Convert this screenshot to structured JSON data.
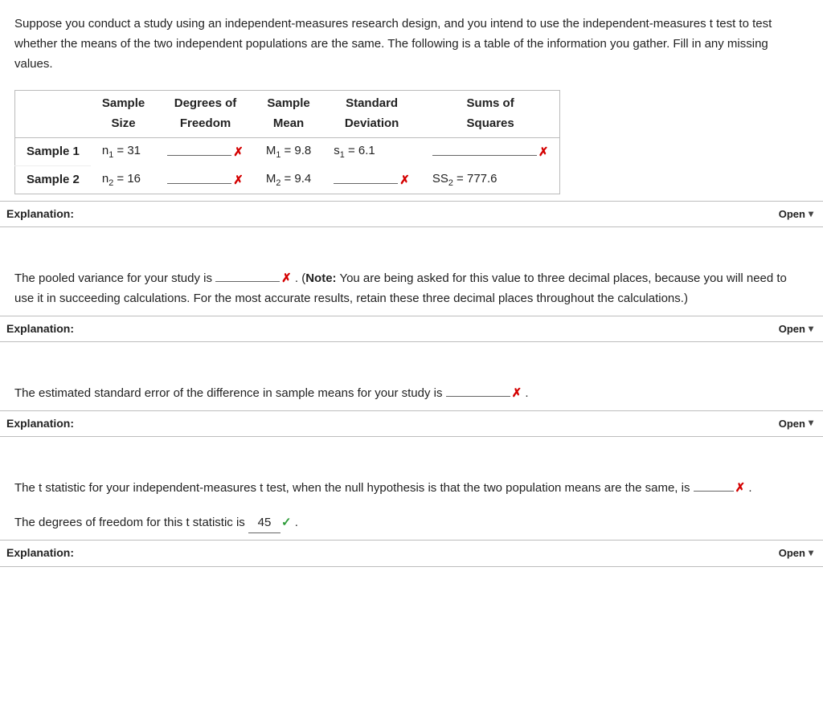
{
  "intro": "Suppose you conduct a study using an independent-measures research design, and you intend to use the independent-measures t test to test whether the means of the two independent populations are the same. The following is a table of the information you gather. Fill in any missing values.",
  "headers": {
    "col1": "",
    "size_l1": "Sample",
    "size_l2": "Size",
    "df_l1": "Degrees of",
    "df_l2": "Freedom",
    "mean_l1": "Sample",
    "mean_l2": "Mean",
    "sd_l1": "Standard",
    "sd_l2": "Deviation",
    "ss_l1": "Sums of",
    "ss_l2": "Squares"
  },
  "rows": {
    "r1": {
      "label": "Sample 1",
      "n_pre": "n",
      "n_sub": "1",
      "n_val": " = 31",
      "m_pre": "M",
      "m_sub": "1",
      "m_val": " = 9.8",
      "s_pre": "s",
      "s_sub": "1",
      "s_val": " = 6.1"
    },
    "r2": {
      "label": "Sample 2",
      "n_pre": "n",
      "n_sub": "2",
      "n_val": " = 16",
      "m_pre": "M",
      "m_sub": "2",
      "m_val": " = 9.4",
      "ss_pre": "SS",
      "ss_sub": "2",
      "ss_val": " = 777.6"
    }
  },
  "marks": {
    "x": "✗",
    "check": "✓"
  },
  "expl": {
    "label": "Explanation:",
    "open": "Open"
  },
  "q2a": "The pooled variance for your study is ",
  "q2b": " . (",
  "q2note": "Note:",
  "q2c": " You are being asked for this value to three decimal places, because you will need to use it in succeeding calculations. For the most accurate results, retain these three decimal places throughout the calculations.)",
  "q3a": "The estimated standard error of the difference in sample means for your study is ",
  "q3b": " .",
  "q4a": "The t statistic for your independent-measures t test, when the null hypothesis is that the two population means are the same, is ",
  "q4b": " .",
  "q5a": "The degrees of freedom for this t statistic is ",
  "q5ans": "45",
  "q5b": " ."
}
